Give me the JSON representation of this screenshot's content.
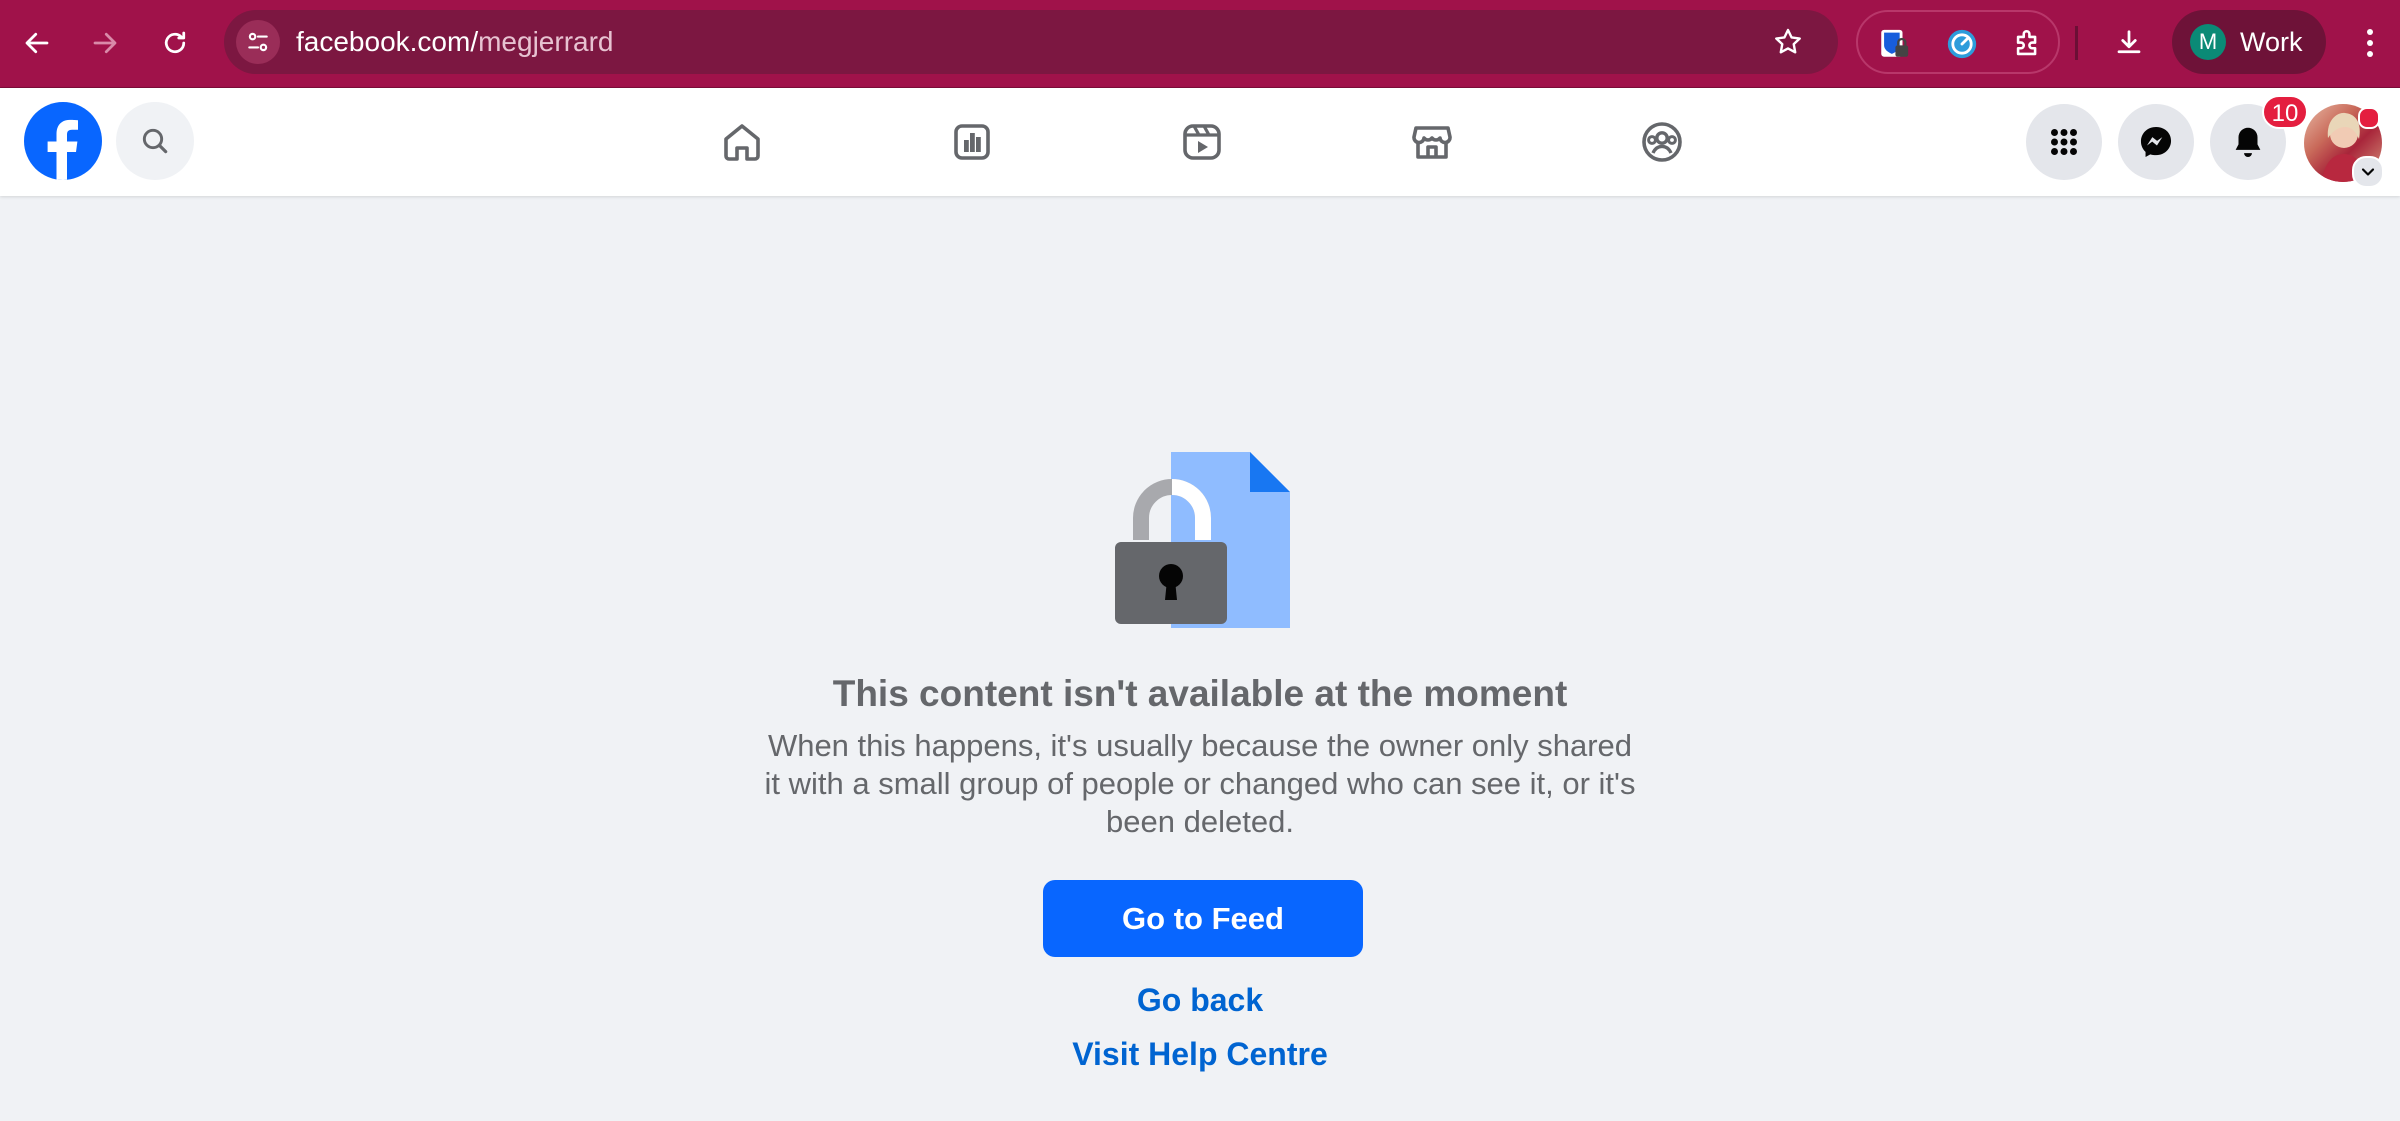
{
  "browser": {
    "url_domain": "facebook.com/",
    "url_path": "megjerrard",
    "profile_initial": "M",
    "profile_name": "Work",
    "theme_color": "#a0124a"
  },
  "facebook": {
    "brand_color": "#0866ff",
    "nav_items": [
      "home-icon",
      "dashboard-icon",
      "video-icon",
      "marketplace-icon",
      "groups-icon"
    ],
    "notification_count": "10"
  },
  "content": {
    "title": "This content isn't available at the moment",
    "description": "When this happens, it's usually because the owner only shared it with a small group of people or changed who can see it, or it's been deleted.",
    "primary_button": "Go to Feed",
    "link_back": "Go back",
    "link_help": "Visit Help Centre"
  }
}
